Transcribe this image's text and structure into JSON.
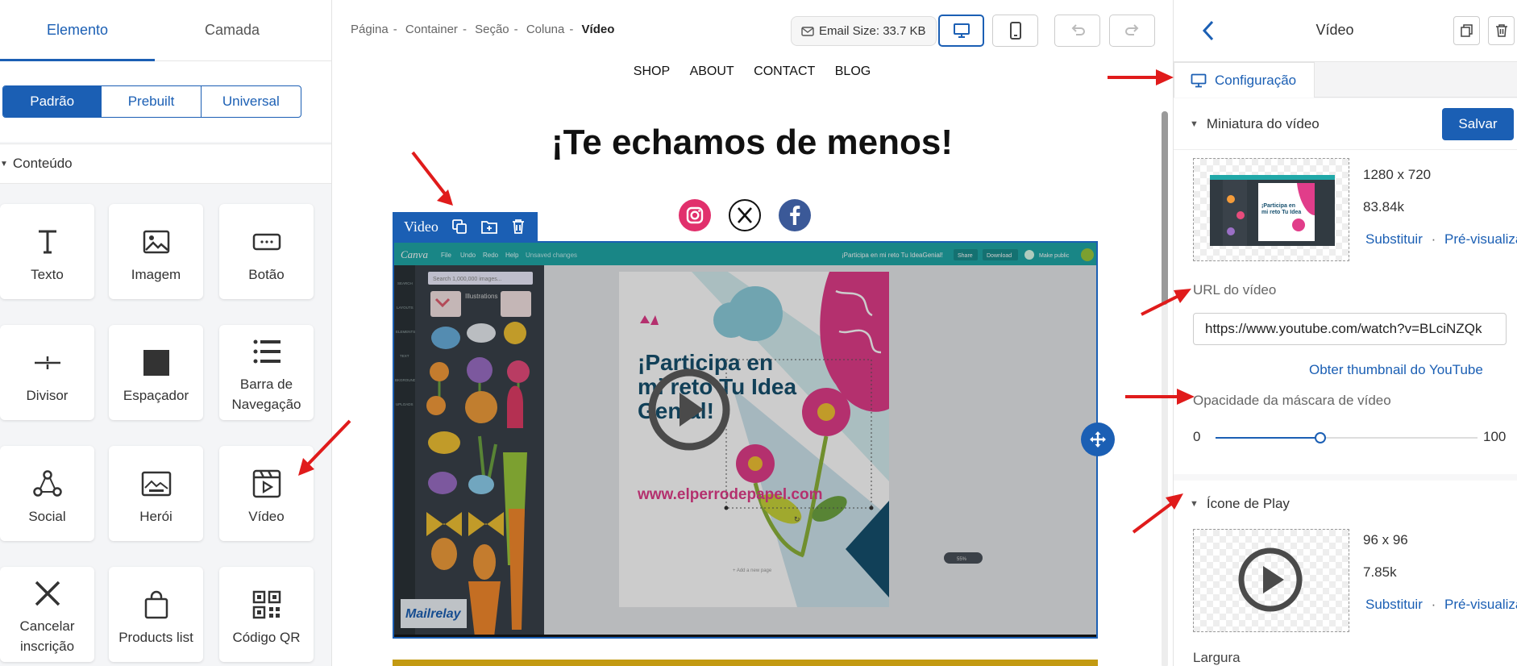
{
  "left": {
    "tabs": [
      "Elemento",
      "Camada"
    ],
    "filters": [
      "Padrão",
      "Prebuilt",
      "Universal"
    ],
    "section": "Conteúdo",
    "tiles": [
      {
        "label": "Texto",
        "icon": "text-icon"
      },
      {
        "label": "Imagem",
        "icon": "image-icon"
      },
      {
        "label": "Botão",
        "icon": "button-icon"
      },
      {
        "label": "Divisor",
        "icon": "divider-icon"
      },
      {
        "label": "Espaçador",
        "icon": "spacer-icon"
      },
      {
        "label": "Barra de Navegação",
        "icon": "navbar-icon"
      },
      {
        "label": "Social",
        "icon": "social-icon"
      },
      {
        "label": "Herói",
        "icon": "hero-icon"
      },
      {
        "label": "Vídeo",
        "icon": "video-icon"
      },
      {
        "label": "Cancelar inscrição",
        "icon": "unsubscribe-icon"
      },
      {
        "label": "Products list",
        "icon": "shopping-bag-icon"
      },
      {
        "label": "Código QR",
        "icon": "qr-code-icon"
      }
    ]
  },
  "center": {
    "breadcrumb": [
      "Página",
      "Container",
      "Seção",
      "Coluna"
    ],
    "breadcrumb_current": "Vídeo",
    "email_size": "Email Size: 33.7 KB",
    "nav": [
      "SHOP",
      "ABOUT",
      "CONTACT",
      "BLOG"
    ],
    "headline": "¡Te echamos de menos!",
    "video_label": "Video",
    "video_frame": {
      "app_menu": [
        "File",
        "Undo",
        "Redo",
        "Help",
        "Unsaved changes"
      ],
      "app_title": "¡Participa en mi reto Tu IdeaGenial!",
      "app_buttons": [
        "Share",
        "Download",
        "Make public"
      ],
      "search_placeholder": "Search 1,000,000 images...",
      "panel_title": "Illustrations",
      "sidebar": [
        "SEARCH",
        "LAYOUTS",
        "ELEMENTS",
        "TEXT",
        "BKGROUND",
        "UPLOADS"
      ],
      "design_text": "¡Participa en mi reto Tu Idea Genial!",
      "design_url": "www.elperrodepapel.com",
      "watermark": "Mailrelay",
      "add_page": "+ Add a new page",
      "zoom": "55%"
    },
    "colors": {
      "accent": "#1b5fb4",
      "gold": "#c39a12",
      "instagram": "#e1306c",
      "facebook": "#3b5998"
    }
  },
  "right": {
    "title": "Vídeo",
    "tab": "Configuração",
    "thumbnail_section": "Miniatura do vídeo",
    "save_label": "Salvar",
    "thumb_dimensions": "1280 x 720",
    "thumb_size": "83.84k",
    "replace": "Substituir",
    "preview": "Pré-visualizar",
    "url_label": "URL do vídeo",
    "url_value": "https://www.youtube.com/watch?v=BLciNZQk",
    "youtube_thumb_link": "Obter thumbnail do YouTube",
    "opacity_label": "Opacidade da máscara de vídeo",
    "opacity_min": "0",
    "opacity_max": "100",
    "opacity_value": 0.4,
    "play_section": "Ícone de Play",
    "play_dimensions": "96 x 96",
    "play_size": "7.85k",
    "width_label": "Largura"
  }
}
